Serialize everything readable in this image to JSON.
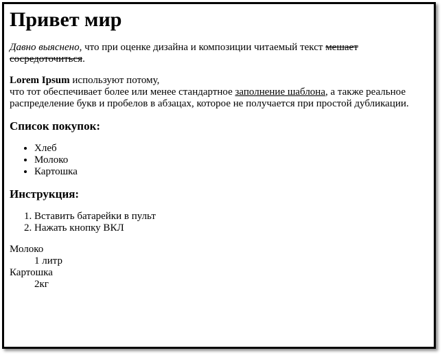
{
  "heading": "Привет мир",
  "p1": {
    "italic": "Давно выяснено",
    "text": ", что при оценке дизайна и композиции читаемый текст ",
    "strike": "мешает сосредоточиться",
    "end": "."
  },
  "p2": {
    "bold": "Lorem Ipsum",
    "line1_rest": " используют потому,",
    "line2_start": "что тот обеспечивает более или менее стандартное ",
    "underline": "заполнение шаблона",
    "line2_rest": ", а также реальное распределение букв и пробелов в абзацах, которое не получается при простой дубликации."
  },
  "shopping": {
    "title": "Список покупок:",
    "items": [
      "Хлеб",
      "Молоко",
      "Картошка"
    ]
  },
  "instructions": {
    "title": "Инструкция:",
    "steps": [
      "Вставить батарейки в пульт",
      "Нажать кнопку ВКЛ"
    ]
  },
  "definitions": [
    {
      "term": "Молоко",
      "desc": "1 литр"
    },
    {
      "term": "Картошка",
      "desc": "2кг"
    }
  ]
}
